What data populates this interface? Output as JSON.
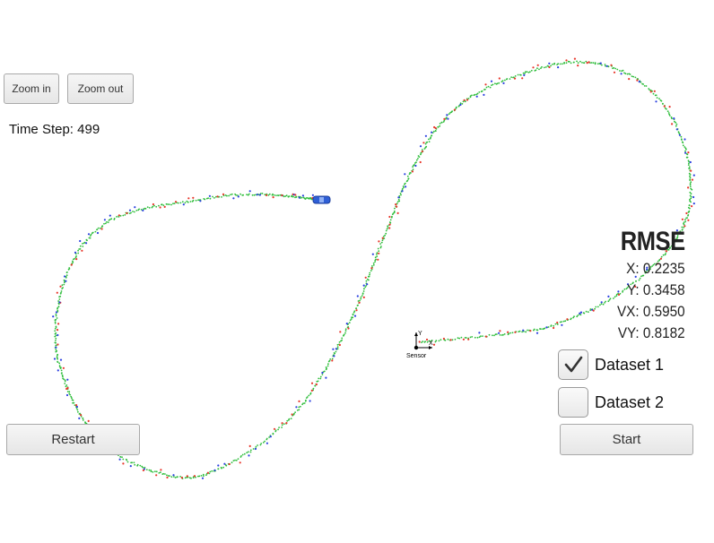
{
  "toolbar": {
    "zoom_in_label": "Zoom in",
    "zoom_out_label": "Zoom out"
  },
  "status": {
    "time_step_label": "Time Step: 499"
  },
  "rmse": {
    "title": "RMSE",
    "x": "X: 0.2235",
    "y": "Y: 0.3458",
    "vx": "VX: 0.5950",
    "vy": "VY: 0.8182"
  },
  "datasets": {
    "dataset1_label": "Dataset 1",
    "dataset1_checked": true,
    "dataset2_label": "Dataset 2",
    "dataset2_checked": false
  },
  "controls": {
    "restart_label": "Restart",
    "start_label": "Start"
  },
  "sensor": {
    "label": "Sensor",
    "axis_x": "X",
    "axis_y": "Y"
  },
  "colors": {
    "estimate": "#2dbd3a",
    "lidar": "#e8352a",
    "radar": "#2a3fe0",
    "car": "#2f5fd6"
  }
}
